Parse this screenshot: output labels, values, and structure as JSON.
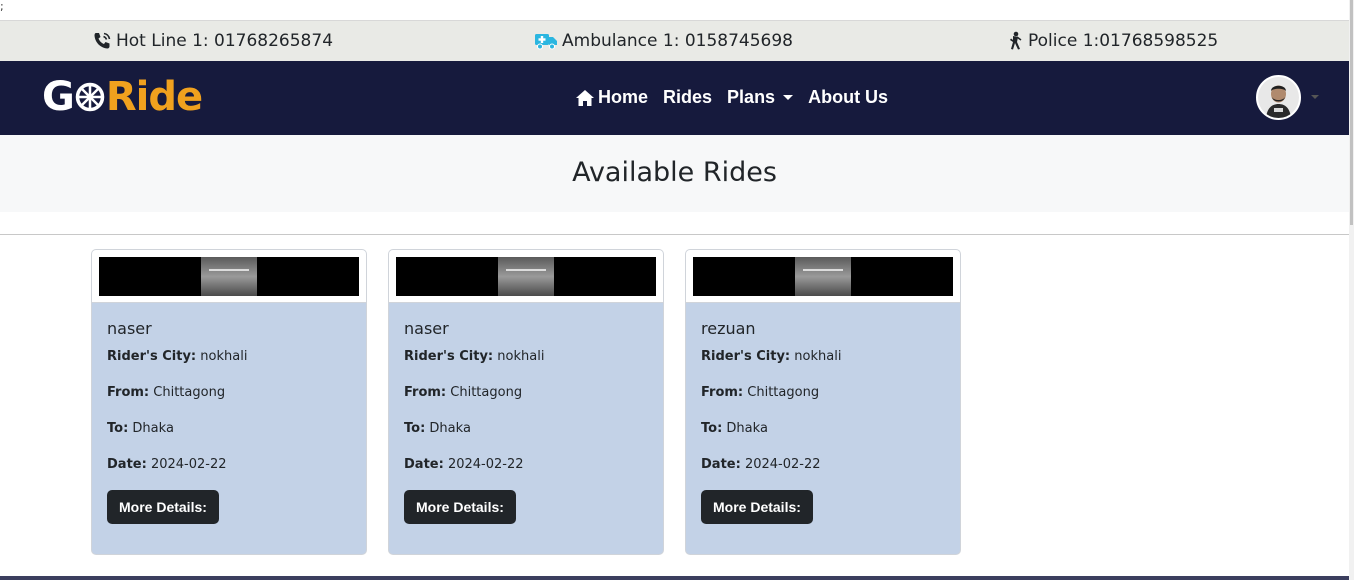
{
  "stray_char": ";",
  "hotlines": [
    {
      "icon": "phone-icon",
      "label": "Hot Line 1: 01768265874"
    },
    {
      "icon": "ambulance-icon",
      "label": "Ambulance 1: 0158745698"
    },
    {
      "icon": "police-icon",
      "label": "Police 1:01768598525"
    }
  ],
  "brand": {
    "part1": "G",
    "part2": "Ride",
    "accent": "#f0a11e",
    "navbar_bg": "#161a3d"
  },
  "nav": {
    "home": "Home",
    "rides": "Rides",
    "plans": "Plans",
    "about": "About Us"
  },
  "page": {
    "title": "Available Rides"
  },
  "rides": [
    {
      "name": "naser",
      "city_label": "Rider's City:",
      "city": "nokhali",
      "from_label": "From:",
      "from": "Chittagong",
      "to_label": "To:",
      "to": "Dhaka",
      "date_label": "Date:",
      "date": "2024-02-22",
      "button": "More Details:"
    },
    {
      "name": "naser",
      "city_label": "Rider's City:",
      "city": "nokhali",
      "from_label": "From:",
      "from": "Chittagong",
      "to_label": "To:",
      "to": "Dhaka",
      "date_label": "Date:",
      "date": "2024-02-22",
      "button": "More Details:"
    },
    {
      "name": "rezuan",
      "city_label": "Rider's City:",
      "city": "nokhali",
      "from_label": "From:",
      "from": "Chittagong",
      "to_label": "To:",
      "to": "Dhaka",
      "date_label": "Date:",
      "date": "2024-02-22",
      "button": "More Details:"
    }
  ]
}
